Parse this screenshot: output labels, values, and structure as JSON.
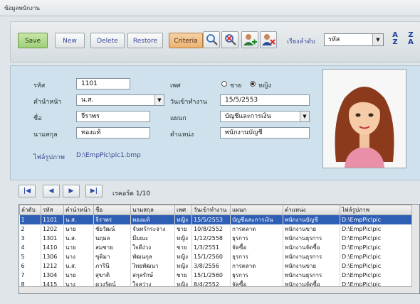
{
  "window": {
    "title": "ข้อมูลพนักงาน"
  },
  "toolbar": {
    "save": "Save",
    "new": "New",
    "delete": "Delete",
    "restore": "Restore",
    "criteria": "Criteria",
    "sort_label": "เรียงลำดับ",
    "sort_value": "รหัส"
  },
  "form": {
    "id_label": "รหัส",
    "id_value": "1101",
    "prefix_label": "คำนำหน้า",
    "prefix_value": "น.ส.",
    "name_label": "ชื่อ",
    "name_value": "จีราพร",
    "surname_label": "นามสกุล",
    "surname_value": "ทองแท้",
    "pic_label": "ไฟล์รูปภาพ",
    "pic_value": "D:\\EmpPic\\pic1.bmp",
    "gender_label": "เพศ",
    "male": "ชาย",
    "female": "หญิง",
    "gender_selected": "female",
    "start_label": "วันเข้าทำงาน",
    "start_value": "15/5/2553",
    "dept_label": "แผนก",
    "dept_value": "บัญชีและการเงิน",
    "pos_label": "ตำแหน่ง",
    "pos_value": "พนักงานบัญชี"
  },
  "nav": {
    "record_label": "เรคอร์ด 1/10"
  },
  "grid": {
    "columns": [
      "ลำดับ",
      "รหัส",
      "คำนำหน้า",
      "ชื่อ",
      "นามสกุล",
      "เพศ",
      "วันเข้าทำงาน",
      "แผนก",
      "ตำแหน่ง",
      "ไฟล์รูปภาพ"
    ],
    "rows": [
      [
        "1",
        "1101",
        "น.ส.",
        "จีราพร",
        "ทองแท้",
        "หญิง",
        "15/5/2553",
        "บัญชีและการเงิน",
        "พนักงานบัญชี",
        "D:\\EmpPic\\pic"
      ],
      [
        "2",
        "1202",
        "นาย",
        "ชัยวัฒน์",
        "จันทร์กระจ่าง",
        "ชาย",
        "10/8/2552",
        "การตลาด",
        "พนักงานขาย",
        "D:\\EmpPic\\pic"
      ],
      [
        "3",
        "1301",
        "น.ส.",
        "นฤมล",
        "มีมณะ",
        "หญิง",
        "1/12/2558",
        "ธุรการ",
        "พนักงานธุรการ",
        "D:\\EmpPic\\pic"
      ],
      [
        "4",
        "1410",
        "นาย",
        "สมชาย",
        "ใจดีง่วง",
        "ชาย",
        "1/3/2551",
        "จัดซื้อ",
        "พนักงานจัดซื้อ",
        "D:\\EmpPic\\pic"
      ],
      [
        "5",
        "1306",
        "นาง",
        "ขุติมา",
        "พัฒนกุล",
        "หญิง",
        "15/1/2560",
        "ธุรการ",
        "พนักงานธุรการ",
        "D:\\EmpPic\\pic"
      ],
      [
        "6",
        "1212",
        "น.ส.",
        "ภารินี",
        "ไทยพัฒนา",
        "หญิง",
        "3/8/2556",
        "การตลาด",
        "พนักงานขาย",
        "D:\\EmpPic\\pic"
      ],
      [
        "7",
        "1304",
        "นาย",
        "สุขาติ",
        "สกุลรักษ์",
        "ชาย",
        "15/1/2560",
        "ธุรการ",
        "พนักงานธุรการ",
        "D:\\EmpPic\\pic"
      ],
      [
        "8",
        "1415",
        "นาง",
        "ดวงรัตน์",
        "ใจสว่าง",
        "หญิง",
        "8/4/2552",
        "จัดซื้อ",
        "พนักงานจัดซื้อ",
        "D:\\EmpPic\\pic"
      ]
    ]
  }
}
